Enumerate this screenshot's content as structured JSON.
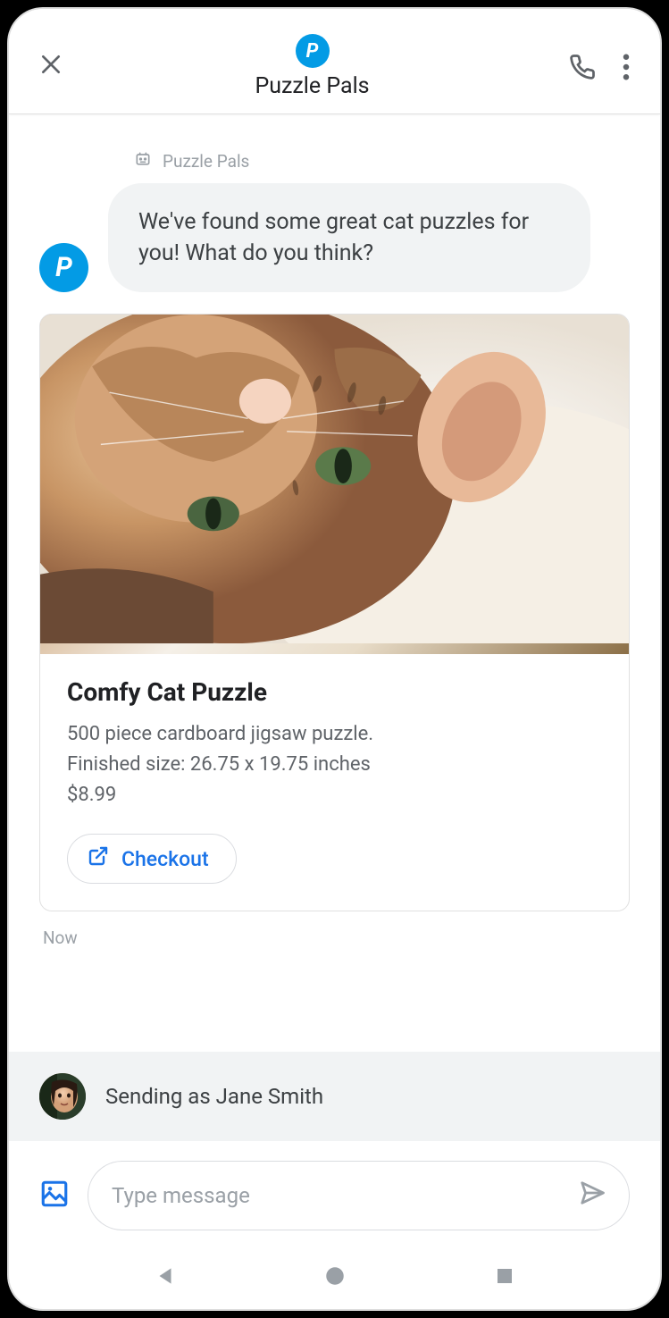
{
  "header": {
    "title": "Puzzle Pals",
    "avatar_letter": "P"
  },
  "chat": {
    "sender_name": "Puzzle Pals",
    "avatar_letter": "P",
    "message_text": "We've found some great cat puzzles for you! What do you think?",
    "card": {
      "title": "Comfy Cat Puzzle",
      "description": "500 piece cardboard jigsaw puzzle.\nFinished size: 26.75 x 19.75 inches\n$8.99",
      "button_label": "Checkout"
    },
    "timestamp": "Now"
  },
  "sending_as": {
    "label": "Sending as Jane Smith"
  },
  "compose": {
    "placeholder": "Type message"
  }
}
